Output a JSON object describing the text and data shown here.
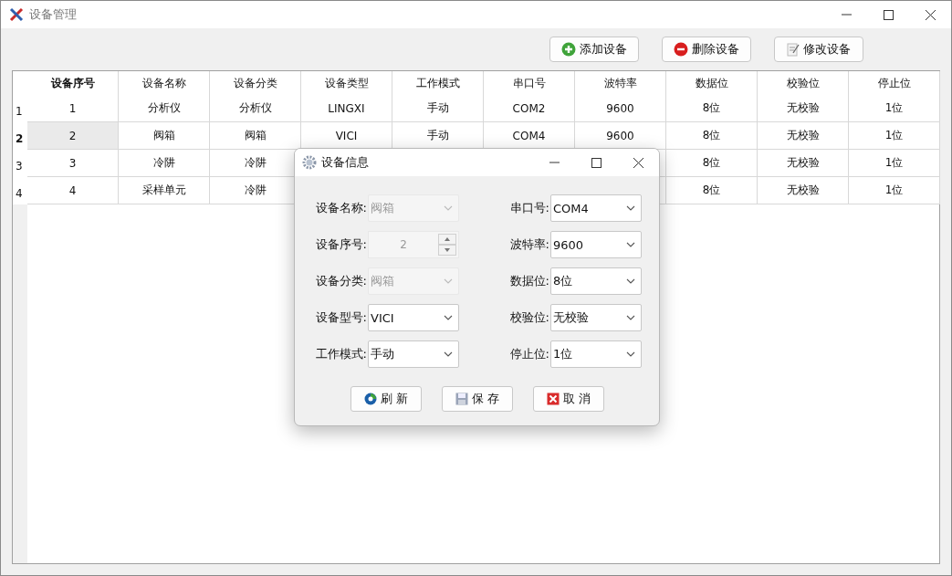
{
  "window": {
    "title": "设备管理"
  },
  "toolbar": [
    {
      "label": "添加设备",
      "kind": "add"
    },
    {
      "label": "删除设备",
      "kind": "delete"
    },
    {
      "label": "修改设备",
      "kind": "edit"
    }
  ],
  "table": {
    "columns": [
      "设备序号",
      "设备名称",
      "设备分类",
      "设备类型",
      "工作模式",
      "串口号",
      "波特率",
      "数据位",
      "校验位",
      "停止位"
    ],
    "rows": [
      {
        "header": "1",
        "selected": false,
        "cells": [
          "1",
          "分析仪",
          "分析仪",
          "LINGXI",
          "手动",
          "COM2",
          "9600",
          "8位",
          "无校验",
          "1位"
        ]
      },
      {
        "header": "2",
        "selected": true,
        "cells": [
          "2",
          "阀箱",
          "阀箱",
          "VICI",
          "手动",
          "COM4",
          "9600",
          "8位",
          "无校验",
          "1位"
        ]
      },
      {
        "header": "3",
        "selected": false,
        "cells": [
          "3",
          "冷阱",
          "冷阱",
          null,
          null,
          null,
          null,
          "8位",
          "无校验",
          "1位"
        ]
      },
      {
        "header": "4",
        "selected": false,
        "cells": [
          "4",
          "采样单元",
          "冷阱",
          null,
          null,
          null,
          null,
          "8位",
          "无校验",
          "1位"
        ]
      }
    ]
  },
  "dialog": {
    "title": "设备信息",
    "left_fields": [
      {
        "label": "设备名称:",
        "value": "阀箱",
        "kind": "combo",
        "disabled": true
      },
      {
        "label": "设备序号:",
        "value": "2",
        "kind": "spin",
        "disabled": true
      },
      {
        "label": "设备分类:",
        "value": "阀箱",
        "kind": "combo",
        "disabled": true
      },
      {
        "label": "设备型号:",
        "value": "VICI",
        "kind": "combo",
        "disabled": false
      },
      {
        "label": "工作模式:",
        "value": "手动",
        "kind": "combo",
        "disabled": false
      }
    ],
    "right_fields": [
      {
        "label": "串口号:",
        "value": "COM4",
        "kind": "combo",
        "disabled": false
      },
      {
        "label": "波特率:",
        "value": "9600",
        "kind": "combo",
        "disabled": false
      },
      {
        "label": "数据位:",
        "value": "8位",
        "kind": "combo",
        "disabled": false
      },
      {
        "label": "校验位:",
        "value": "无校验",
        "kind": "combo",
        "disabled": false
      },
      {
        "label": "停止位:",
        "value": "1位",
        "kind": "combo",
        "disabled": false
      }
    ],
    "buttons": [
      {
        "label": "刷 新",
        "kind": "refresh"
      },
      {
        "label": "保 存",
        "kind": "save"
      },
      {
        "label": "取 消",
        "kind": "cancel"
      }
    ]
  }
}
